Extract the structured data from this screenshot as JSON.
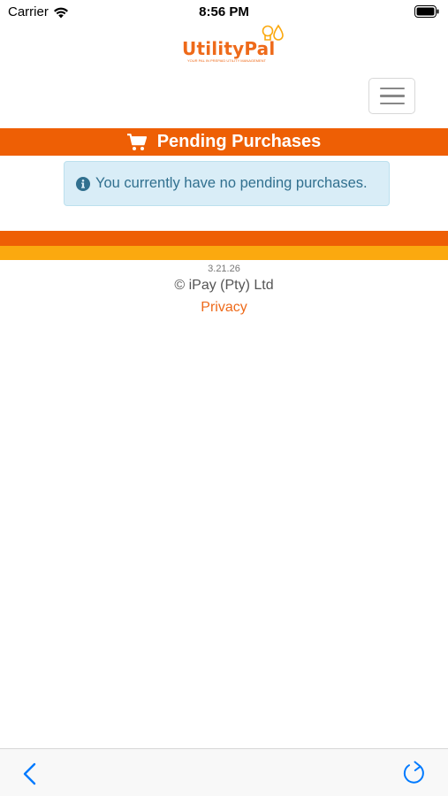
{
  "status_bar": {
    "carrier": "Carrier",
    "time": "8:56 PM"
  },
  "logo": {
    "name": "UtilityPal",
    "tagline": "YOUR PAL IN PREPAID UTILITY MANAGEMENT"
  },
  "banner": {
    "title": "Pending Purchases",
    "icon": "shopping-cart-icon"
  },
  "alert": {
    "icon": "info-circle-icon",
    "message": "You currently have no pending purchases."
  },
  "footer": {
    "version": "3.21.26",
    "copyright": "© iPay (Pty) Ltd",
    "privacy_link": "Privacy"
  },
  "toolbar": {
    "back_icon": "chevron-left-icon",
    "reload_icon": "reload-icon"
  },
  "colors": {
    "brand_orange": "#ee5f05",
    "brand_yellow": "#fba90f",
    "alert_bg": "#d9edf7",
    "alert_text": "#31708f",
    "ios_blue": "#007aff"
  }
}
